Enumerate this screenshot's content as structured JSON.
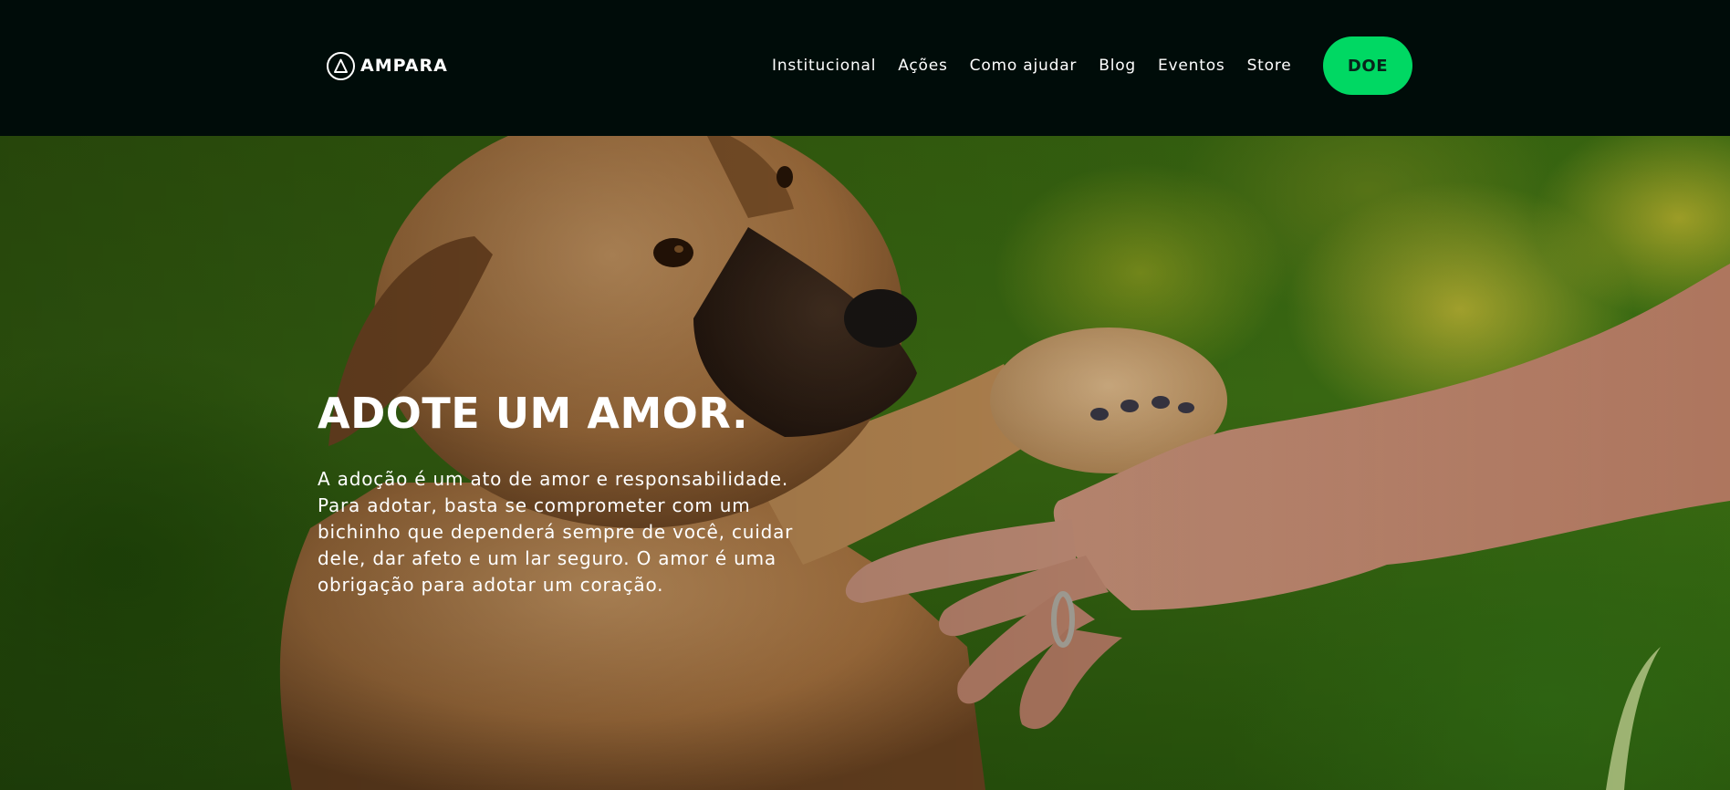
{
  "header": {
    "brand": {
      "name": "AMPARA",
      "icon": "ampara-logo-icon"
    },
    "nav": [
      {
        "label": "Institucional"
      },
      {
        "label": "Ações"
      },
      {
        "label": "Como ajudar"
      },
      {
        "label": "Blog"
      },
      {
        "label": "Eventos"
      },
      {
        "label": "Store"
      }
    ],
    "donate_label": "DOE"
  },
  "hero": {
    "title": "ADOTE UM AMOR.",
    "text": "A adoção é um ato de amor e responsabilidade. Para adotar, basta se comprometer com um bichinho que dependerá sempre de você, cuidar dele, dar afeto e um lar seguro. O amor é uma obrigação para adotar um coração."
  },
  "colors": {
    "header_background": "#000c09",
    "accent": "#00d863",
    "accent_text": "#07231a",
    "text": "#ffffff"
  }
}
